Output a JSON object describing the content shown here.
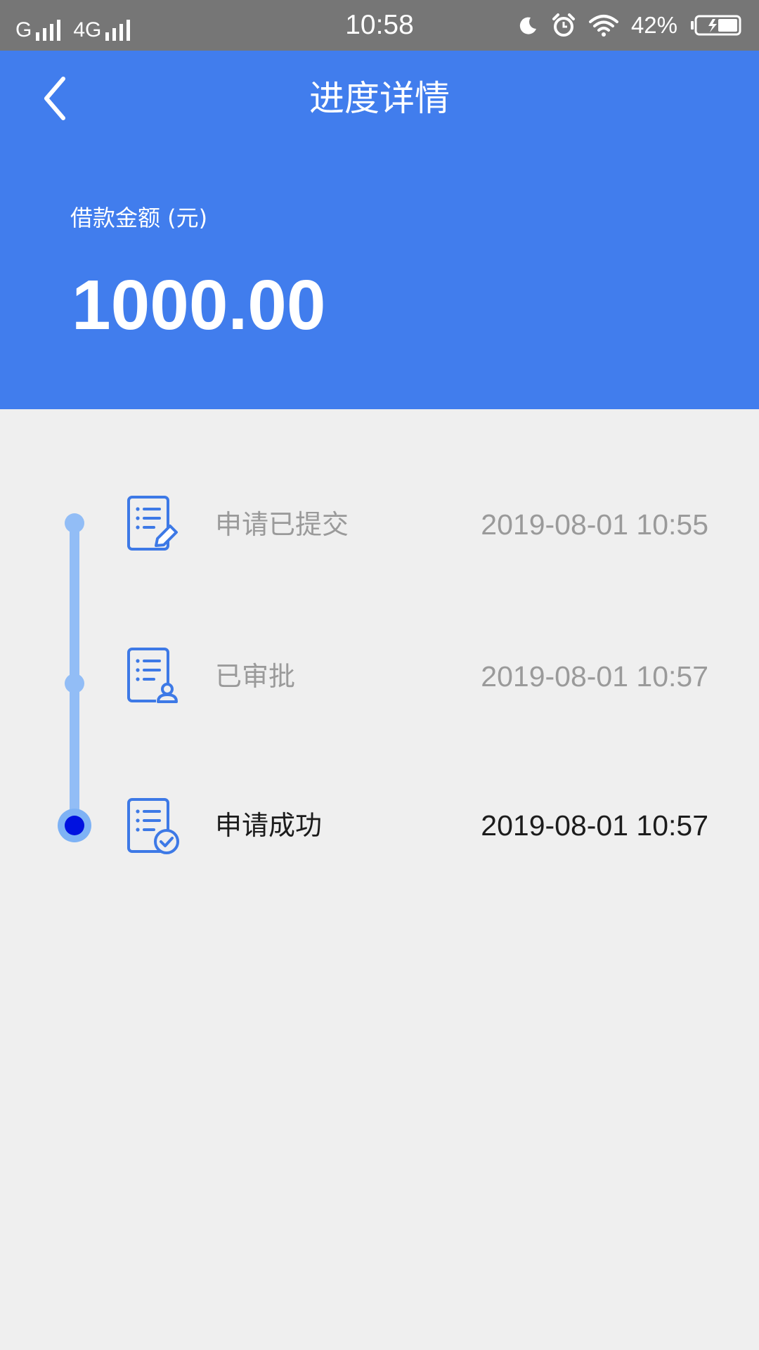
{
  "status_bar": {
    "carrier1": "G",
    "carrier2": "4G",
    "time": "10:58",
    "battery_pct": "42%",
    "icons": [
      "signal-icon",
      "moon-icon",
      "alarm-icon",
      "wifi-icon",
      "battery-icon"
    ]
  },
  "header": {
    "title": "进度详情",
    "back_icon": "chevron-left-icon",
    "amount_label": "借款金额 (元)",
    "amount_value": "1000.00",
    "background_color": "#417ded"
  },
  "timeline": {
    "line_color": "#92bdf6",
    "active_dot_color": "#0011e0",
    "steps": [
      {
        "label": "申请已提交",
        "time": "2019-08-01 10:55",
        "icon": "document-edit-icon",
        "state": "done"
      },
      {
        "label": "已审批",
        "time": "2019-08-01 10:57",
        "icon": "document-user-icon",
        "state": "done"
      },
      {
        "label": "申请成功",
        "time": "2019-08-01 10:57",
        "icon": "document-check-icon",
        "state": "current"
      }
    ]
  }
}
